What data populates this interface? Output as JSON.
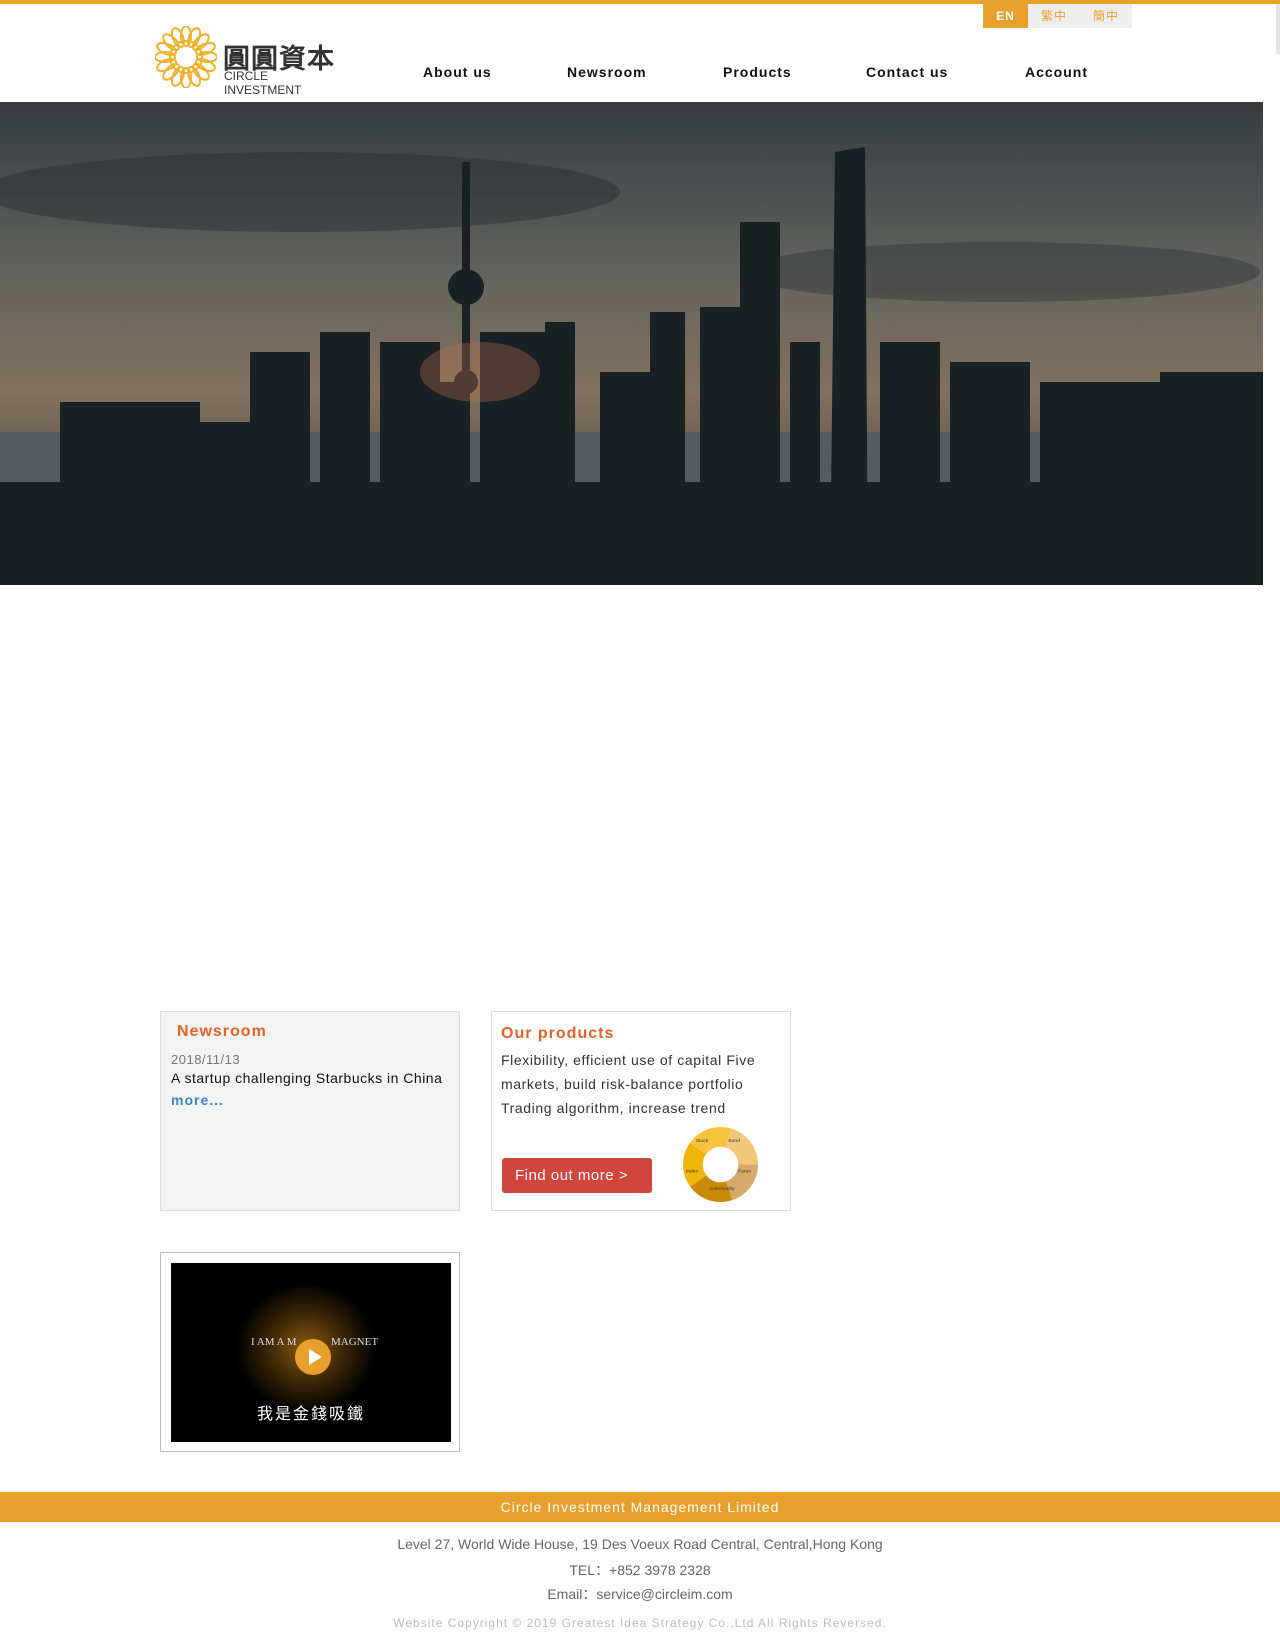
{
  "colors": {
    "accent": "#e8a02c",
    "heading": "#e2622a",
    "button": "#d2453d",
    "link": "#3a87c2"
  },
  "lang": {
    "en": "EN",
    "tc": "繁中",
    "sc": "簡中"
  },
  "logo": {
    "cn": "圓圓資本",
    "en": "CIRCLE INVESTMENT"
  },
  "nav": [
    "About us",
    "Newsroom",
    "Products",
    "Contact us",
    "Account"
  ],
  "newsroom": {
    "title": "Newsroom",
    "date": "2018/11/13",
    "headline": "A startup challenging Starbucks in China",
    "more": "more..."
  },
  "products": {
    "title": "Our products",
    "lines": [
      "Flexibility, efficient use of capital Five",
      "markets, build risk-balance portfolio",
      "Trading algorithm, increase trend"
    ],
    "button": "Find out more >",
    "donut_labels": [
      "Stock",
      "Bond",
      "Forex",
      "Commodity",
      "Index"
    ]
  },
  "video": {
    "title_left": "I AM A M",
    "title_right": "MAGNET",
    "subtitle": "我是金錢吸鐵",
    "icon": "play-icon"
  },
  "footer": {
    "company": "Circle Investment Management Limited",
    "address": "Level 27, World Wide House, 19 Des Voeux Road Central, Central,Hong Kong",
    "tel": "TEL：+852 3978 2328",
    "email": "Email：service@circleim.com",
    "copyright": "Website Copyright © 2019 Greatest Idea Strategy Co.,Ltd All Rights Reversed."
  }
}
